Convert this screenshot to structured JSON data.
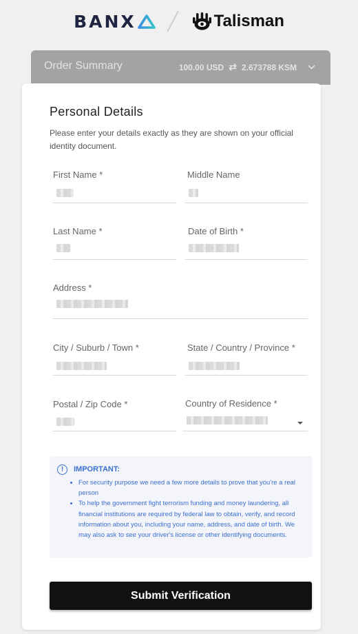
{
  "header": {
    "partner_logo_text": "BANX",
    "brand_name": "Talisman"
  },
  "order_summary": {
    "title": "Order Summary",
    "pay_amount": "100.00 USD",
    "receive_amount": "2.673788 KSM",
    "swap_icon": "swap-arrows",
    "toggle_icon": "chevron-down"
  },
  "form": {
    "title": "Personal Details",
    "intro": "Please enter your details exactly as they are shown on your official identity document.",
    "fields": {
      "first_name": "First Name *",
      "middle_name": "Middle Name",
      "last_name": "Last Name *",
      "dob": "Date of Birth *",
      "address": "Address *",
      "city": "City / Suburb / Town *",
      "state": "State / Country / Province *",
      "postal": "Postal / Zip Code *",
      "country": "Country of Residence *"
    }
  },
  "notice": {
    "title": "IMPORTANT:",
    "items": [
      "For security purpose we need a few more details to prove that you're a real person",
      "To help the government fight terrorism funding and money laundering, all financial institutions are required by federal law to obtain, verify, and record information about you, including your name, address, and date of birth. We may also ask to see your driver's license or other identifying documents."
    ]
  },
  "submit_label": "Submit Verification",
  "colors": {
    "accent_blue": "#3b6fd1",
    "banxa_navy": "#1f2441",
    "banxa_teal": "#35c6c8",
    "submit_bg": "#111111"
  }
}
